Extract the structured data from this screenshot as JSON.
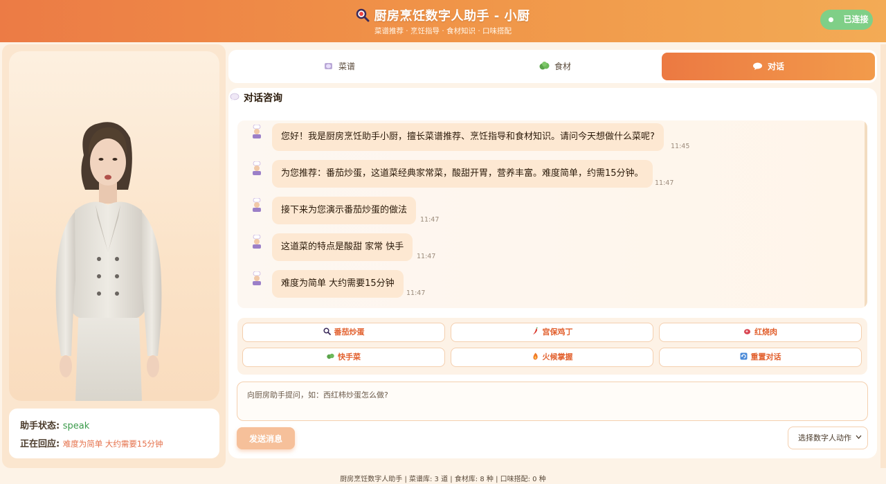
{
  "header": {
    "title": "厨房烹饪数字人助手 - 小厨",
    "subtitle": "菜谱推荐 · 烹饪指导 · 食材知识 · 口味搭配",
    "status_badge": "已连接",
    "logo_icon": "magnifier-icon"
  },
  "colors": {
    "accent": "#ec7b45",
    "accent_light": "#f3ab55",
    "bubble": "#fde8d2",
    "connected": "#7fcf87",
    "quick_text": "#e2612f"
  },
  "tabs": [
    {
      "label": "菜谱",
      "icon": "plate-icon",
      "active": false
    },
    {
      "label": "食材",
      "icon": "vegetable-icon",
      "active": false
    },
    {
      "label": "对话",
      "icon": "speech-bubble-icon",
      "active": true
    }
  ],
  "chat": {
    "title": "对话咨询",
    "messages": [
      {
        "text": "您好！我是厨房烹饪助手小厨，擅长菜谱推荐、烹饪指导和食材知识。请问今天想做什么菜呢?",
        "time": "11:45"
      },
      {
        "text": "为您推荐：番茄炒蛋，这道菜经典家常菜，酸甜开胃，营养丰富。难度简单，约需15分钟。",
        "time": "11:47"
      },
      {
        "text": "接下来为您演示番茄炒蛋的做法",
        "time": "11:47"
      },
      {
        "text": "这道菜的特点是酸甜 家常 快手",
        "time": "11:47"
      },
      {
        "text": "难度为简单 大约需要15分钟",
        "time": "11:47"
      }
    ]
  },
  "quick_actions": [
    {
      "label": "番茄炒蛋",
      "icon": "magnifier-icon"
    },
    {
      "label": "宫保鸡丁",
      "icon": "chili-icon"
    },
    {
      "label": "红烧肉",
      "icon": "meat-icon"
    },
    {
      "label": "快手菜",
      "icon": "vegetable-icon"
    },
    {
      "label": "火候掌握",
      "icon": "fire-icon"
    },
    {
      "label": "重置对话",
      "icon": "reset-icon"
    }
  ],
  "input": {
    "placeholder": "向厨房助手提问，如：西红柿炒蛋怎么做?",
    "value": ""
  },
  "send_button": "发送消息",
  "action_select": {
    "selected": "选择数字人动作"
  },
  "assistant_status": {
    "status_label": "助手状态:",
    "status_value": "speak",
    "reply_label": "正在回应:",
    "reply_value": "难度为简单 大约需要15分钟"
  },
  "footer": "厨房烹饪数字人助手 | 菜谱库: 3 道 | 食材库: 8 种 | 口味搭配: 0 种"
}
